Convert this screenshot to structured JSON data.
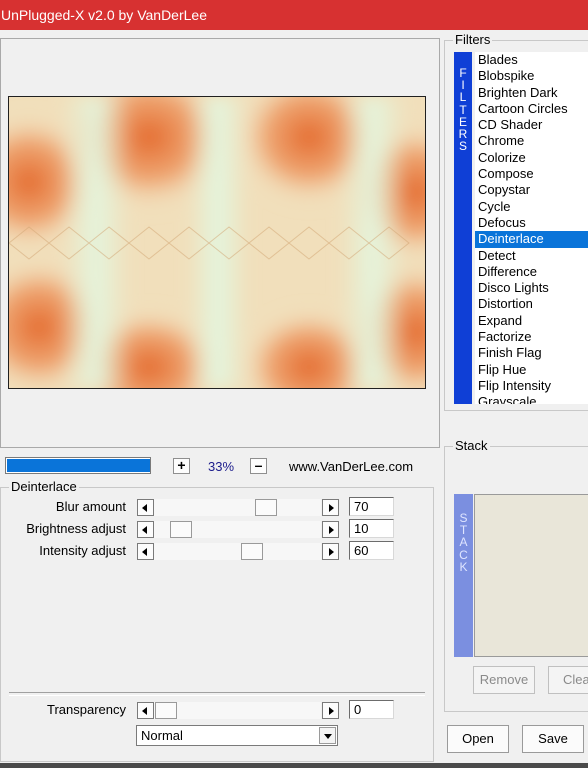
{
  "window": {
    "title": "UnPlugged-X v2.0 by VanDerLee"
  },
  "zoom": {
    "progress_percent": 100,
    "plus_label": "+",
    "value": "33%",
    "minus_label": "–",
    "website": "www.VanDerLee.com"
  },
  "deinterlace": {
    "title": "Deinterlace",
    "sliders": [
      {
        "label": "Blur amount",
        "value": "70"
      },
      {
        "label": "Brightness adjust",
        "value": "10"
      },
      {
        "label": "Intensity adjust",
        "value": "60"
      }
    ]
  },
  "transparency": {
    "label": "Transparency",
    "value": "0"
  },
  "blend_mode": {
    "selected": "Normal"
  },
  "filters": {
    "title": "Filters",
    "side_label": "FILTERS",
    "items": [
      "Blades",
      "Blobspike",
      "Brighten Dark",
      "Cartoon Circles",
      "CD Shader",
      "Chrome",
      "Colorize",
      "Compose",
      "Copystar",
      "Cycle",
      "Defocus",
      "Deinterlace",
      "Detect",
      "Difference",
      "Disco Lights",
      "Distortion",
      "Expand",
      "Factorize",
      "Finish Flag",
      "Flip Hue",
      "Flip Intensity",
      "Grayscale"
    ],
    "selected": "Deinterlace"
  },
  "stack": {
    "title": "Stack",
    "side_label": "STACK",
    "remove_label": "Remove",
    "clear_label": "Clea"
  },
  "actions": {
    "open_label": "Open",
    "save_label": "Save"
  },
  "colors": {
    "titlebar": "#d73131",
    "selection": "#0a74d9",
    "filter_strip": "#0f3fd6",
    "stack_strip": "#7b8fe0"
  }
}
